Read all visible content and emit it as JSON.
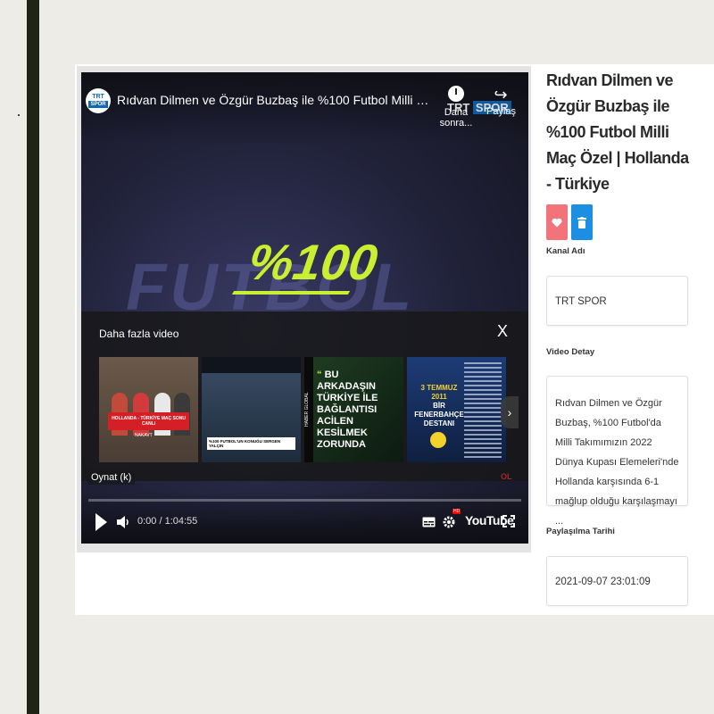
{
  "player": {
    "channel_logo_top": "TRT",
    "channel_logo_bottom": "SPOR",
    "video_title": "Rıdvan Dilmen ve Özgür Buzbaş ile %100 Futbol Milli Maç Özel | Hollanda - Türkiye",
    "watch_later_label": "Daha sonra...",
    "share_label": "Paylaş",
    "watermark_trt": "TRT",
    "watermark_spor": "SPOR",
    "brand_text": "%100",
    "ghost_text": "FUTBOL",
    "more_videos": {
      "title": "Daha fazla video",
      "close_glyph": "X",
      "thumbnails": [
        {
          "banner": "HOLLANDA - TÜRKİYE MAÇ SONU CANLI",
          "sub": "NAKAVT"
        },
        {
          "caption": "%100 FUTBOL'UN KONUĞU SERGEN YALÇIN"
        },
        {
          "side": "HABER GLOBAL",
          "quote_mark": "“",
          "quote": "BU ARKADAŞIN TÜRKİYE İLE BAĞLANTISI ACİLEN KESİLMEK ZORUNDA"
        },
        {
          "date": "3 TEMMUZ 2011",
          "line2": "BİR FENERBAHÇE",
          "line3": "DESTANI"
        }
      ],
      "next_glyph": "›"
    },
    "play_hint": "Oynat (k)",
    "ghost_brand": "OL",
    "controls": {
      "time": "0:00 / 1:04:55",
      "hd_badge": "HD",
      "youtube_label": "YouTube",
      "progress": 0
    }
  },
  "details": {
    "title": "Rıdvan Dilmen ve Özgür Buzbaş ile %100 Futbol Milli Maç Özel | Hollanda - Türkiye",
    "channel_label": "Kanal Adı",
    "channel_value": "TRT SPOR",
    "detail_label": "Video Detay",
    "detail_value": "Rıdvan Dilmen ve Özgür Buzbaş, %100 Futbol'da Milli Takımımızın 2022 Dünya Kupası Elemeleri'nde Hollanda karşısında 6-1 mağlup olduğu karşılaşmayı ...",
    "date_label": "Paylaşılma Tarihi",
    "date_value": "2021-09-07 23:01:09"
  },
  "colors": {
    "like_button": "#f2747a",
    "delete_button": "#1d8fe2",
    "brand_accent": "#c9ef31",
    "progress_red": "#ff0000"
  },
  "icons": [
    "clock-icon",
    "share-icon",
    "heart-icon",
    "trash-icon",
    "play-icon",
    "volume-icon",
    "subtitles-icon",
    "settings-icon",
    "fullscreen-icon",
    "close-icon",
    "chevron-right-icon"
  ]
}
